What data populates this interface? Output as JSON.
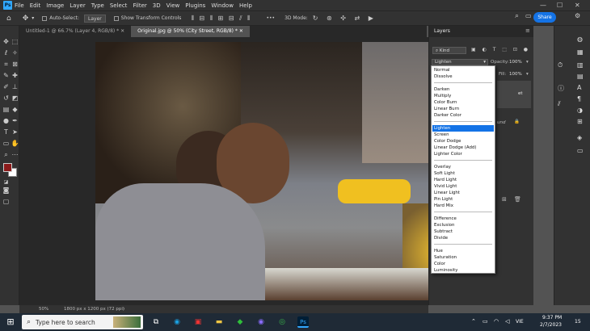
{
  "menubar": {
    "logo": "Ps",
    "items": [
      "File",
      "Edit",
      "Image",
      "Layer",
      "Type",
      "Select",
      "Filter",
      "3D",
      "View",
      "Plugins",
      "Window",
      "Help"
    ]
  },
  "options": {
    "auto_select_label": "Auto-Select:",
    "auto_select_value": "Layer",
    "transform_label": "Show Transform Controls",
    "mode_label": "3D Mode:",
    "share_label": "Share"
  },
  "tabs": [
    {
      "label": "Untitled-1 @ 66.7% (Layer 4, RGB/8) *"
    },
    {
      "label": "Original.jpg @ 50% (City Street, RGB/8) *"
    }
  ],
  "layers_panel": {
    "title": "Layers",
    "kind_label": "Kind",
    "opacity_label": "Opacity:",
    "opacity_value": "100%",
    "fill_label": "Fill:",
    "fill_value": "100%",
    "blend_mode_current": "Lighten",
    "partial_text_1": "et",
    "partial_text_2": "und"
  },
  "blend_modes": {
    "group1": [
      "Normal",
      "Dissolve"
    ],
    "group2": [
      "Darken",
      "Multiply",
      "Color Burn",
      "Linear Burn",
      "Darker Color"
    ],
    "group3": [
      "Lighten",
      "Screen",
      "Color Dodge",
      "Linear Dodge (Add)",
      "Lighter Color"
    ],
    "group4": [
      "Overlay",
      "Soft Light",
      "Hard Light",
      "Vivid Light",
      "Linear Light",
      "Pin Light",
      "Hard Mix"
    ],
    "group5": [
      "Difference",
      "Exclusion",
      "Subtract",
      "Divide"
    ],
    "group6": [
      "Hue",
      "Saturation",
      "Color",
      "Luminosity"
    ]
  },
  "status": {
    "zoom": "50%",
    "doc_info": "1800 px x 1200 px (72 ppi)"
  },
  "taskbar": {
    "search_placeholder": "Type here to search",
    "lang": "VIE",
    "time": "9:37 PM",
    "date": "2/7/2023",
    "notif_count": "15"
  },
  "colors": {
    "accent": "#1473e6",
    "panel": "#323232",
    "foreground_swatch": "#8b1a1a"
  }
}
